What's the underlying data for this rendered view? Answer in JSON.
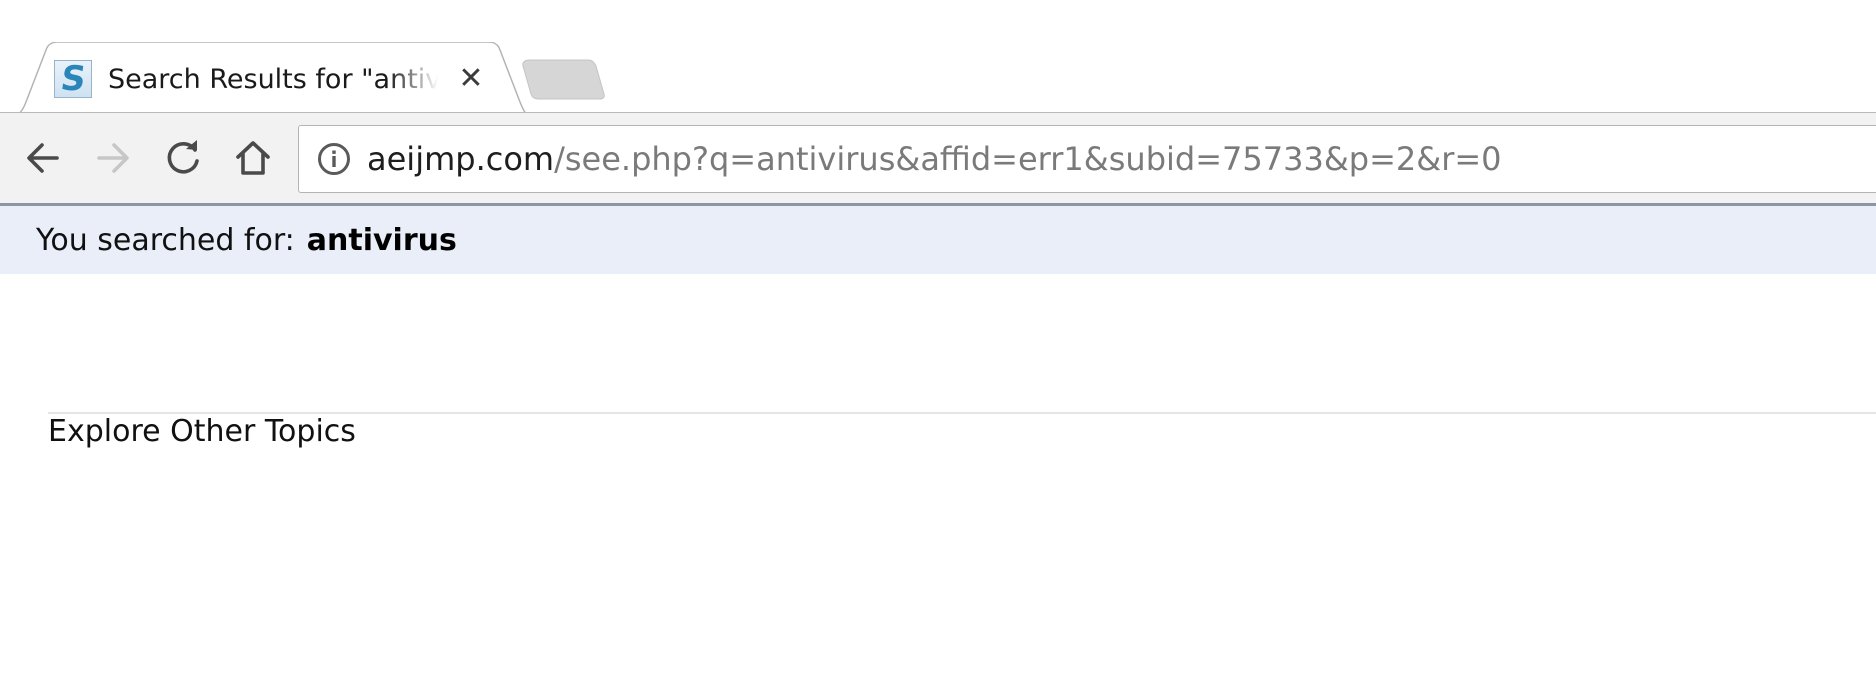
{
  "browser": {
    "tab": {
      "title": "Search Results for \"antivirus\"",
      "favicon_letter": "S",
      "close_glyph": "✕"
    },
    "address_bar": {
      "host": "aeijmp.com",
      "path": "/see.php?q=antivirus&affid=err1&subid=75733&p=2&r=0"
    }
  },
  "page": {
    "searched_label": "You searched for:",
    "search_term": "antivirus",
    "explore_heading": "Explore Other Topics"
  },
  "colors": {
    "searched_bar_bg": "#e9eef8",
    "toolbar_bg": "#f2f2f2",
    "favicon_accent": "#2a85b8"
  }
}
